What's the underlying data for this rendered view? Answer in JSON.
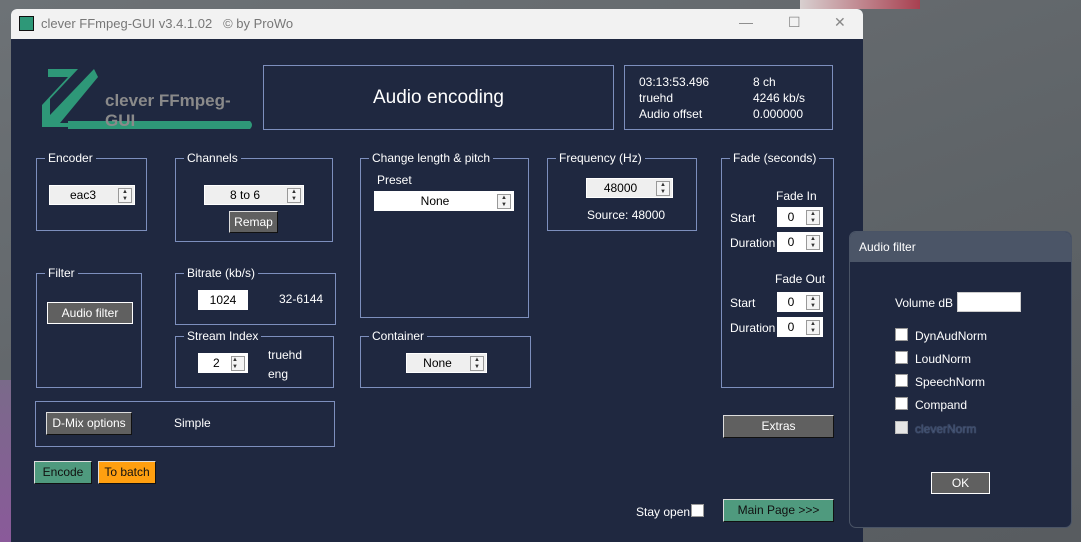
{
  "window": {
    "title": "clever FFmpeg-GUI v3.4.1.02   © by ProWo",
    "minimize": "—",
    "maximize": "☐",
    "close": "✕"
  },
  "logo": {
    "text": "clever FFmpeg-GUI"
  },
  "header": {
    "title": "Audio encoding"
  },
  "info": {
    "duration": "03:13:53.496",
    "channels": "8 ch",
    "codec": "truehd",
    "bitrate": "4246 kb/s",
    "offset_label": "Audio offset",
    "offset_value": "0.000000"
  },
  "encoder": {
    "label": "Encoder",
    "value": "eac3"
  },
  "channels": {
    "label": "Channels",
    "value": "8 to 6",
    "remap": "Remap"
  },
  "change_length": {
    "label": "Change length & pitch",
    "preset_label": "Preset",
    "preset_value": "None"
  },
  "frequency": {
    "label": "Frequency (Hz)",
    "value": "48000",
    "source": "Source: 48000"
  },
  "fade": {
    "label": "Fade (seconds)",
    "fade_in": "Fade In",
    "fade_out": "Fade Out",
    "start": "Start",
    "duration": "Duration",
    "in_start": "0",
    "in_duration": "0",
    "out_start": "0",
    "out_duration": "0"
  },
  "filter": {
    "label": "Filter",
    "button": "Audio filter"
  },
  "bitrate": {
    "label": "Bitrate (kb/s)",
    "value": "1024",
    "range": "32-6144"
  },
  "stream": {
    "label": "Stream Index",
    "value": "2",
    "codec": "truehd",
    "lang": "eng"
  },
  "container": {
    "label": "Container",
    "value": "None"
  },
  "dmix": {
    "button": "D-Mix options",
    "value": "Simple"
  },
  "actions": {
    "encode": "Encode",
    "batch": "To batch",
    "extras": "Extras",
    "stay_open": "Stay open",
    "main_page": "Main Page >>>"
  },
  "dialog": {
    "title": "Audio filter",
    "volume_label": "Volume dB",
    "volume_value": "",
    "checks": [
      "DynAudNorm",
      "LoudNorm",
      "SpeechNorm",
      "Compand",
      "cleverNorm"
    ],
    "ok": "OK"
  },
  "colors": {
    "bg": "#1f2840",
    "accent": "#2e9878",
    "orange": "#ff9f10"
  }
}
